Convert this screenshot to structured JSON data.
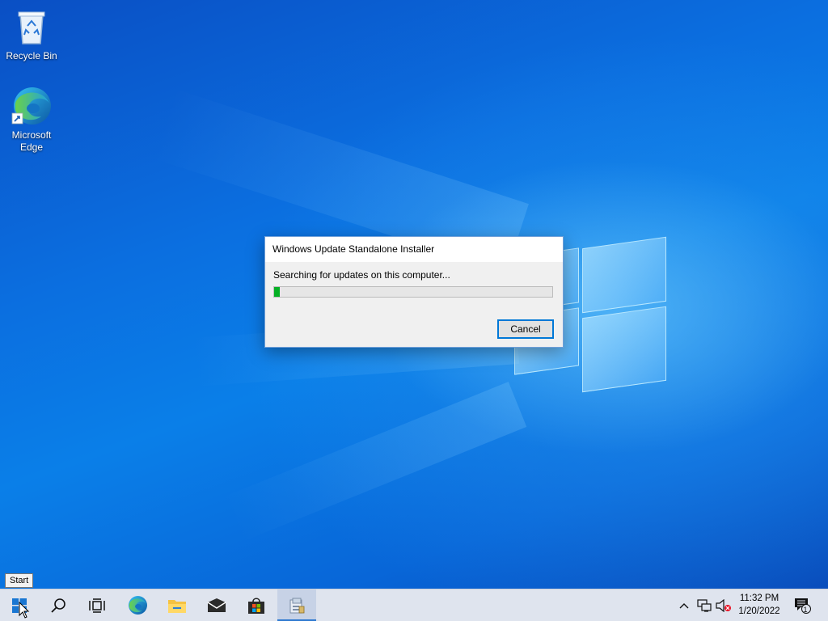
{
  "desktop": {
    "icons": [
      {
        "label": "Recycle Bin",
        "icon": "recycle-bin-icon"
      },
      {
        "label": "Microsoft Edge",
        "icon": "edge-icon"
      }
    ]
  },
  "dialog": {
    "title": "Windows Update Standalone Installer",
    "status": "Searching for updates on this computer...",
    "progress_percent": 2,
    "cancel_label": "Cancel"
  },
  "tooltip": {
    "text": "Start"
  },
  "taskbar": {
    "buttons": [
      {
        "name": "start",
        "icon": "windows-logo-icon"
      },
      {
        "name": "search",
        "icon": "search-icon"
      },
      {
        "name": "task-view",
        "icon": "task-view-icon"
      },
      {
        "name": "edge",
        "icon": "edge-icon"
      },
      {
        "name": "file-explorer",
        "icon": "folder-icon"
      },
      {
        "name": "mail",
        "icon": "mail-icon"
      },
      {
        "name": "store",
        "icon": "store-icon"
      },
      {
        "name": "installer",
        "icon": "installer-icon",
        "active": true
      }
    ],
    "tray": {
      "icons": [
        "chevron-up-icon",
        "network-icon",
        "volume-muted-icon"
      ],
      "time": "11:32 PM",
      "date": "1/20/2022",
      "notification_count": "1"
    }
  },
  "colors": {
    "progress": "#06b025",
    "accent": "#0078d7",
    "taskbar": "#dfe4ee"
  }
}
